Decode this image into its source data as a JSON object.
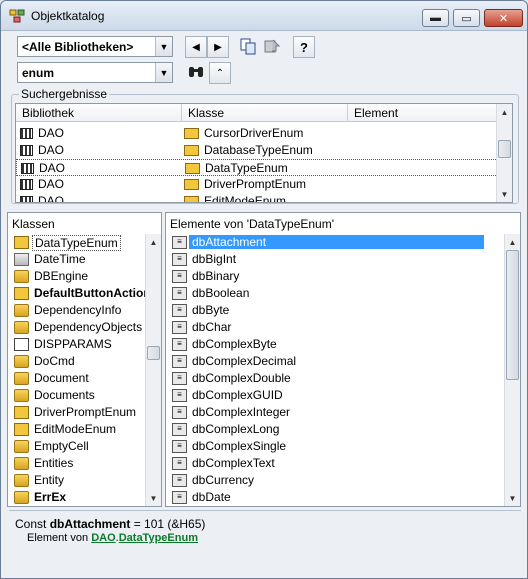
{
  "window": {
    "title": "Objektkatalog",
    "controls": {
      "minimize": "▬",
      "maximize": "▭",
      "close": "✕"
    }
  },
  "toolbar": {
    "library_combo": "<Alle Bibliotheken>",
    "search_combo": "enum",
    "back_icon": "◀",
    "forward_icon": "▶",
    "copy_icon": "copy-icon",
    "view_definition_icon": "view-definition-icon",
    "help_icon": "?",
    "search_icon": "binoculars-icon",
    "toggle_results_icon": "⌃"
  },
  "search_results": {
    "label": "Suchergebnisse",
    "columns": [
      "Bibliothek",
      "Klasse",
      "Element"
    ],
    "rows": [
      {
        "library": "DAO",
        "class": "CursorDriverEnum",
        "element": ""
      },
      {
        "library": "DAO",
        "class": "DatabaseTypeEnum",
        "element": ""
      },
      {
        "library": "DAO",
        "class": "DataTypeEnum",
        "element": "",
        "selected": true
      },
      {
        "library": "DAO",
        "class": "DriverPromptEnum",
        "element": ""
      },
      {
        "library": "DAO",
        "class": "EditModeEnum",
        "element": ""
      }
    ]
  },
  "classes_pane": {
    "label": "Klassen",
    "items": [
      {
        "name": "DataTypeEnum",
        "icon": "enum-icon",
        "focused": true
      },
      {
        "name": "DateTime",
        "icon": "datetime-icon"
      },
      {
        "name": "DBEngine",
        "icon": "class-icon"
      },
      {
        "name": "DefaultButtonAction",
        "icon": "enum-icon",
        "bold": true
      },
      {
        "name": "DependencyInfo",
        "icon": "class-icon"
      },
      {
        "name": "DependencyObjects",
        "icon": "class-icon"
      },
      {
        "name": "DISPPARAMS",
        "icon": "type-icon"
      },
      {
        "name": "DoCmd",
        "icon": "class-icon"
      },
      {
        "name": "Document",
        "icon": "class-icon"
      },
      {
        "name": "Documents",
        "icon": "class-icon"
      },
      {
        "name": "DriverPromptEnum",
        "icon": "enum-icon"
      },
      {
        "name": "EditModeEnum",
        "icon": "enum-icon"
      },
      {
        "name": "EmptyCell",
        "icon": "class-icon"
      },
      {
        "name": "Entities",
        "icon": "class-icon"
      },
      {
        "name": "Entity",
        "icon": "class-icon"
      },
      {
        "name": "ErrEx",
        "icon": "class-icon",
        "bold": true
      }
    ]
  },
  "members_pane": {
    "label": "Elemente von 'DataTypeEnum'",
    "items": [
      {
        "name": "dbAttachment",
        "selected": true
      },
      {
        "name": "dbBigInt"
      },
      {
        "name": "dbBinary"
      },
      {
        "name": "dbBoolean"
      },
      {
        "name": "dbByte"
      },
      {
        "name": "dbChar"
      },
      {
        "name": "dbComplexByte"
      },
      {
        "name": "dbComplexDecimal"
      },
      {
        "name": "dbComplexDouble"
      },
      {
        "name": "dbComplexGUID"
      },
      {
        "name": "dbComplexInteger"
      },
      {
        "name": "dbComplexLong"
      },
      {
        "name": "dbComplexSingle"
      },
      {
        "name": "dbComplexText"
      },
      {
        "name": "dbCurrency"
      },
      {
        "name": "dbDate"
      }
    ]
  },
  "details": {
    "const_prefix": "Const ",
    "const_name": "dbAttachment",
    "const_value": " = 101 (&H65)",
    "member_of_prefix": "Element von ",
    "library_link": "DAO",
    "separator": ".",
    "class_link": "DataTypeEnum"
  },
  "colors": {
    "selection": "#3399ff",
    "link": "#0a7a2a",
    "close_button": "#c4402b"
  }
}
